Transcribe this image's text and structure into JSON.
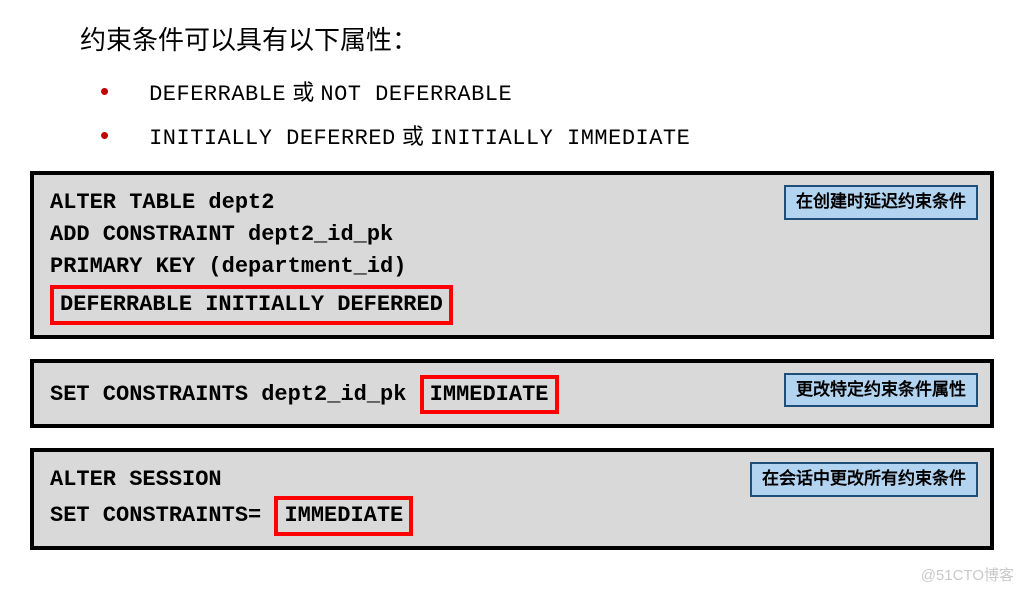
{
  "title": "约束条件可以具有以下属性：",
  "bullets": [
    {
      "code1": "DEFERRABLE",
      "mid": " 或 ",
      "code2": "NOT DEFERRABLE"
    },
    {
      "code1": "INITIALLY DEFERRED",
      "mid": " 或 ",
      "code2": "INITIALLY IMMEDIATE"
    }
  ],
  "box1": {
    "badge": "在创建时延迟约束条件",
    "line1": "ALTER TABLE dept2",
    "line2": "ADD CONSTRAINT dept2_id_pk",
    "line3": "PRIMARY KEY (department_id)",
    "highlight": "DEFERRABLE INITIALLY DEFERRED"
  },
  "box2": {
    "badge": "更改特定约束条件属性",
    "prefix": "SET CONSTRAINTS dept2_id_pk ",
    "highlight": "IMMEDIATE"
  },
  "box3": {
    "badge": "在会话中更改所有约束条件",
    "line1": "ALTER SESSION",
    "prefix": "SET CONSTRAINTS= ",
    "highlight": "IMMEDIATE"
  },
  "watermark": "@51CTO博客"
}
